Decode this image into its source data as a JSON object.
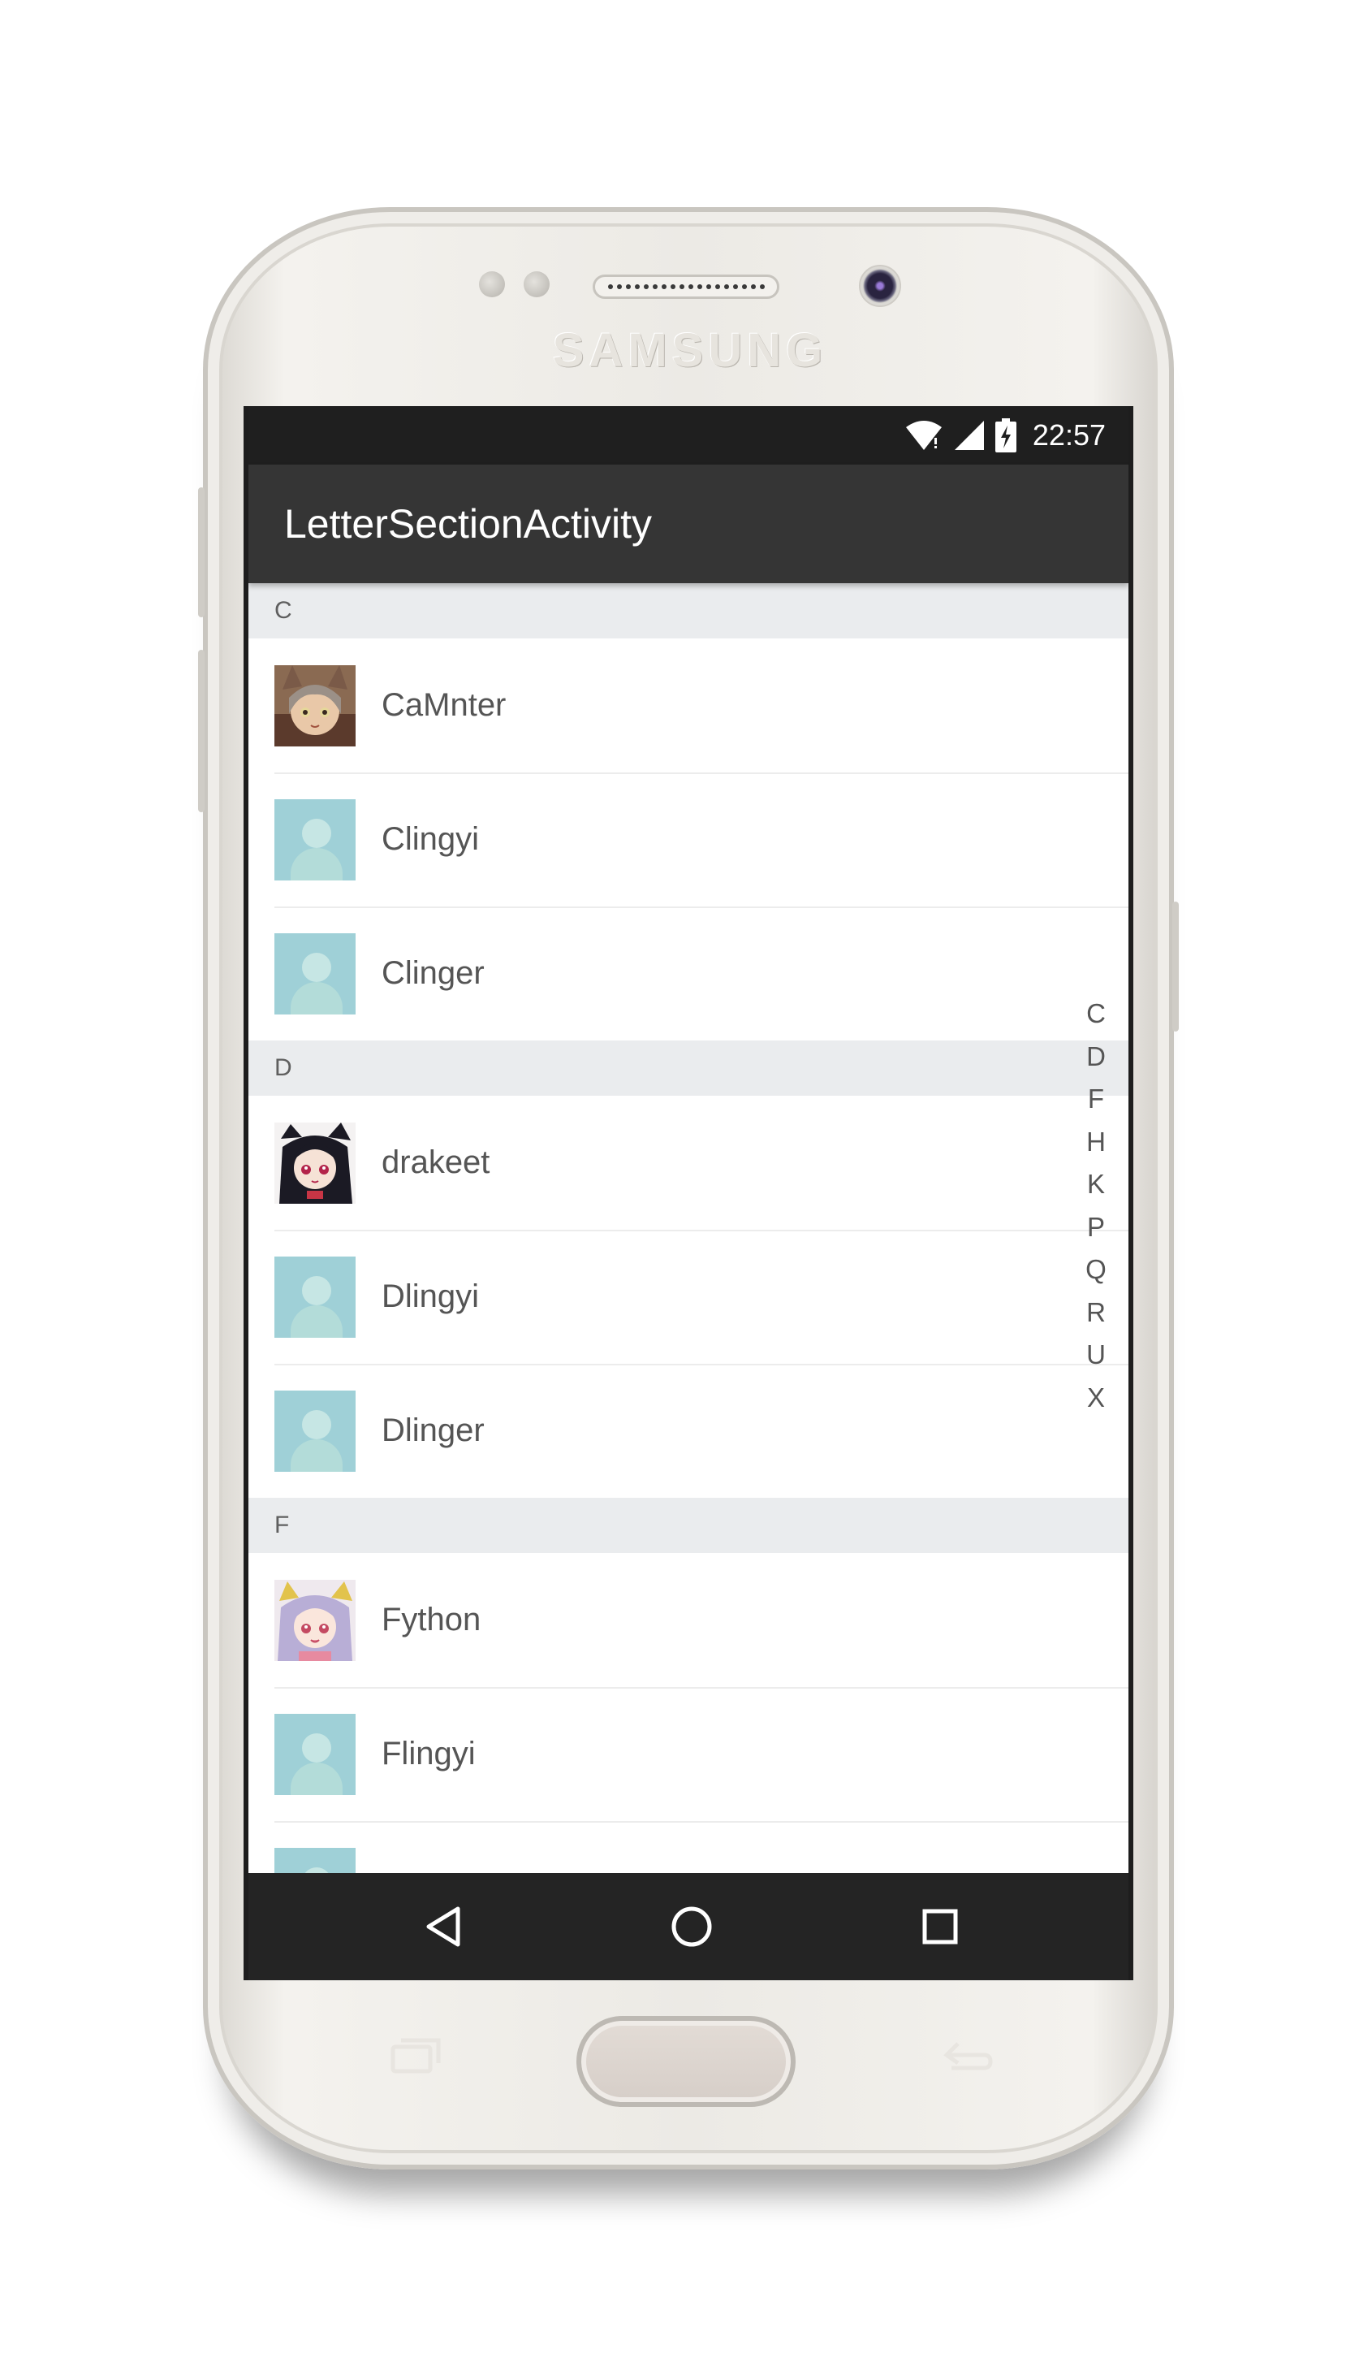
{
  "device": {
    "brand": "SAMSUNG"
  },
  "status_bar": {
    "time": "22:57",
    "icons": [
      "wifi-icon",
      "signal-icon",
      "battery-charging-icon"
    ]
  },
  "app_bar": {
    "title": "LetterSectionActivity"
  },
  "sections": [
    {
      "letter": "C",
      "items": [
        {
          "name": "CaMnter",
          "avatar": "photo-cat-girl"
        },
        {
          "name": "Clingyi",
          "avatar": "placeholder-person-icon"
        },
        {
          "name": "Clinger",
          "avatar": "placeholder-person-icon"
        }
      ]
    },
    {
      "letter": "D",
      "items": [
        {
          "name": "drakeet",
          "avatar": "photo-dark-hair-girl"
        },
        {
          "name": "Dlingyi",
          "avatar": "placeholder-person-icon"
        },
        {
          "name": "Dlinger",
          "avatar": "placeholder-person-icon"
        }
      ]
    },
    {
      "letter": "F",
      "items": [
        {
          "name": "Fython",
          "avatar": "photo-purple-hair-girl"
        },
        {
          "name": "Flingyi",
          "avatar": "placeholder-person-icon"
        },
        {
          "name": "",
          "avatar": "placeholder-person-icon"
        }
      ]
    }
  ],
  "index_letters": [
    "C",
    "D",
    "F",
    "H",
    "K",
    "P",
    "Q",
    "R",
    "U",
    "X"
  ],
  "nav_bar": {
    "icons": [
      "back-icon",
      "home-icon",
      "recents-icon"
    ]
  }
}
